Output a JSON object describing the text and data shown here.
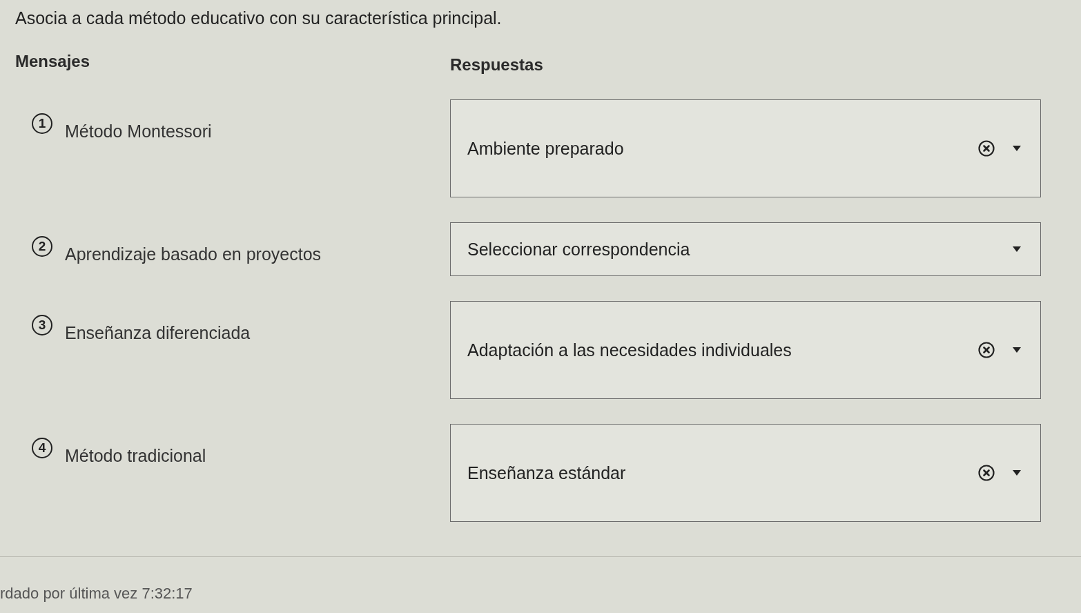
{
  "instruction": "Asocia a cada método educativo con su característica principal.",
  "columns": {
    "left_heading": "Mensajes",
    "right_heading": "Respuestas"
  },
  "pairs": [
    {
      "number": "1",
      "message": "Método Montessori",
      "answer": {
        "value": "Ambiente preparado"
      }
    },
    {
      "number": "2",
      "message": "Aprendizaje basado en proyectos",
      "answer": {
        "placeholder": "Seleccionar correspondencia"
      }
    },
    {
      "number": "3",
      "message": "Enseñanza diferenciada",
      "answer": {
        "value": "Adaptación a las necesidades individuales"
      }
    },
    {
      "number": "4",
      "message": "Método tradicional",
      "answer": {
        "value": "Enseñanza estándar"
      }
    }
  ],
  "footer": {
    "saved_text": "rdado por última vez 7:32:17"
  }
}
